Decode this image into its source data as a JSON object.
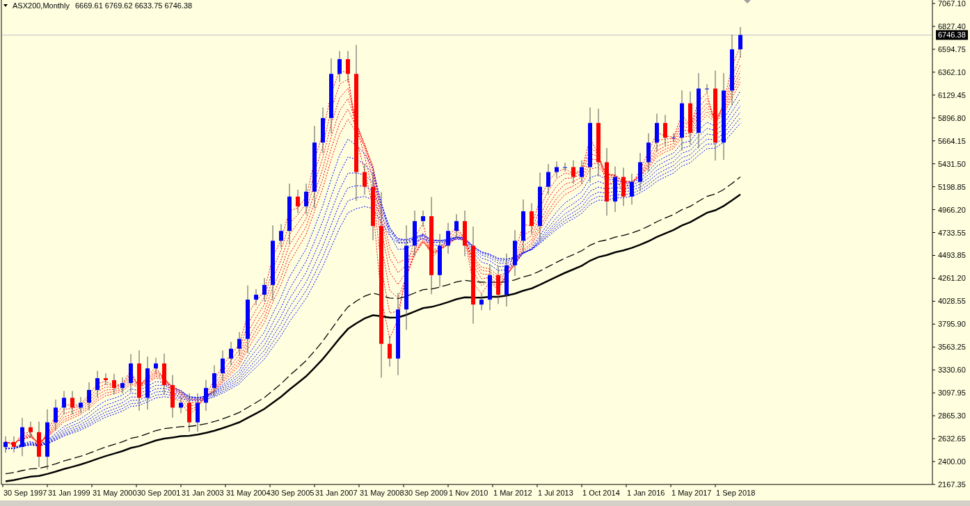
{
  "header": {
    "symbol": "ASX200,Monthly",
    "ohlc": "6669.61 6769.62 6633.75 6746.38"
  },
  "chart": {
    "current_price": "6746.38",
    "price_axis": [
      "7067.10",
      "6827.40",
      "6594.75",
      "6362.10",
      "6129.45",
      "5896.80",
      "5664.15",
      "5431.50",
      "5198.85",
      "4966.20",
      "4733.55",
      "4493.85",
      "4261.20",
      "4028.55",
      "3795.90",
      "3563.25",
      "3330.60",
      "3097.95",
      "2865.30",
      "2632.65",
      "2400.00",
      "2167.35"
    ],
    "date_axis": [
      "30 Sep 1997",
      "31 Jan 1999",
      "31 May 2000",
      "30 Sep 2001",
      "31 Jan 2003",
      "31 May 2004",
      "30 Sep 2005",
      "31 Jan 2007",
      "31 May 2008",
      "30 Sep 2009",
      "1 Nov 2010",
      "1 Mar 2012",
      "1 Jul 2013",
      "1 Oct 2014",
      "1 Jan 2016",
      "1 May 2017",
      "1 Sep 2018"
    ]
  }
}
